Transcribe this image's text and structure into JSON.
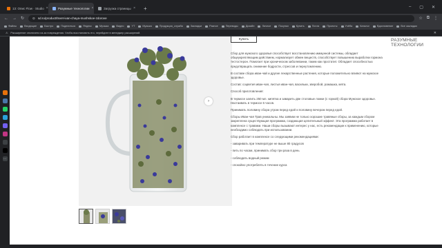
{
  "browser": {
    "tabs": [
      {
        "label": "13: Опис Flow · Studio",
        "active": false
      },
      {
        "label": "Разумные технологии",
        "active": true
      },
      {
        "label": "Загрузка страницы",
        "active": false
      }
    ],
    "url": "sd.ru/product/tsvet-ivan-chaya-mushskoe-zdorove",
    "url_prefix": "sd.ru",
    "bookmarks": [
      "Файлы",
      "Входящие",
      "Быстро",
      "Поделиться",
      "Яндекс",
      "Музыка",
      "Видео",
      "YT",
      "Музыка",
      "Продукция_служба",
      "Закладки",
      "Разное",
      "Переводы",
      "Дизайн",
      "Личное",
      "Покупки",
      "Купить",
      "Почта",
      "Проекты",
      "Учёба",
      "Каталог",
      "Вдохновение",
      "Все закладки"
    ],
    "infobar_text": "Расширение отключено из-за повреждения. Чтобы восстановить его, перейдите в менеджер расширений."
  },
  "product": {
    "buy_label": "Купить",
    "brand_line1": "Разумные",
    "brand_line2": "технологии",
    "paragraphs": [
      "Сбор для мужского здоровья способствует восстановлению иммунной системы, обладает общеукрепляющим действием, нормализует обмен веществ, способствует повышению выработки гормона тестостерон. Помогает при хроническом заболевании, таким как простатит. Обладает способностью предотвращать снижение бодрости, стрессов и переутомлению.",
      "В составе сбора иван-чай и другие лекарственные растения, которые положительно влияют на мужское здоровье.",
      "Состав: соцветия иван-чая, листья иван-чая, васильки, зверобой, ромашка, мята.",
      "Способ приготовления:",
      "В термосе залить 250 мл. кипятка и заварить две столовые ложки (с горкой) сбора Мужское здоровье. Настаивать в термосе 6 часов.",
      "Принимать половину сбора утром перед едой и половину вечером перед едой.",
      "Сборы Иван-чая Трав уникальны. Мы заявим не только хорошие травяные сборы, за каждым сбором закреплена существующая программа, создающая целительный эффект. Эта программа работает в комплексе с травами. Наши сборы вызывают интерес у нас, есть рекомендации к применению, которые необходимо соблюдать при использовании.",
      "Сбор работает в комплексе со следующими рекомендациями:",
      "- заваривать при температуре не выше 80 градусов",
      "- пить по часам, принимать сбор три раза в день",
      "- соблюдать водный режим",
      "- спокойно употреблять в течение курса"
    ]
  },
  "gallery": {
    "thumb_count": 3,
    "prev_icon": "‹",
    "next_icon": "›"
  },
  "colors": {
    "accent_purple": "#3a3a9a",
    "herb_green": "#6b7a4a"
  }
}
